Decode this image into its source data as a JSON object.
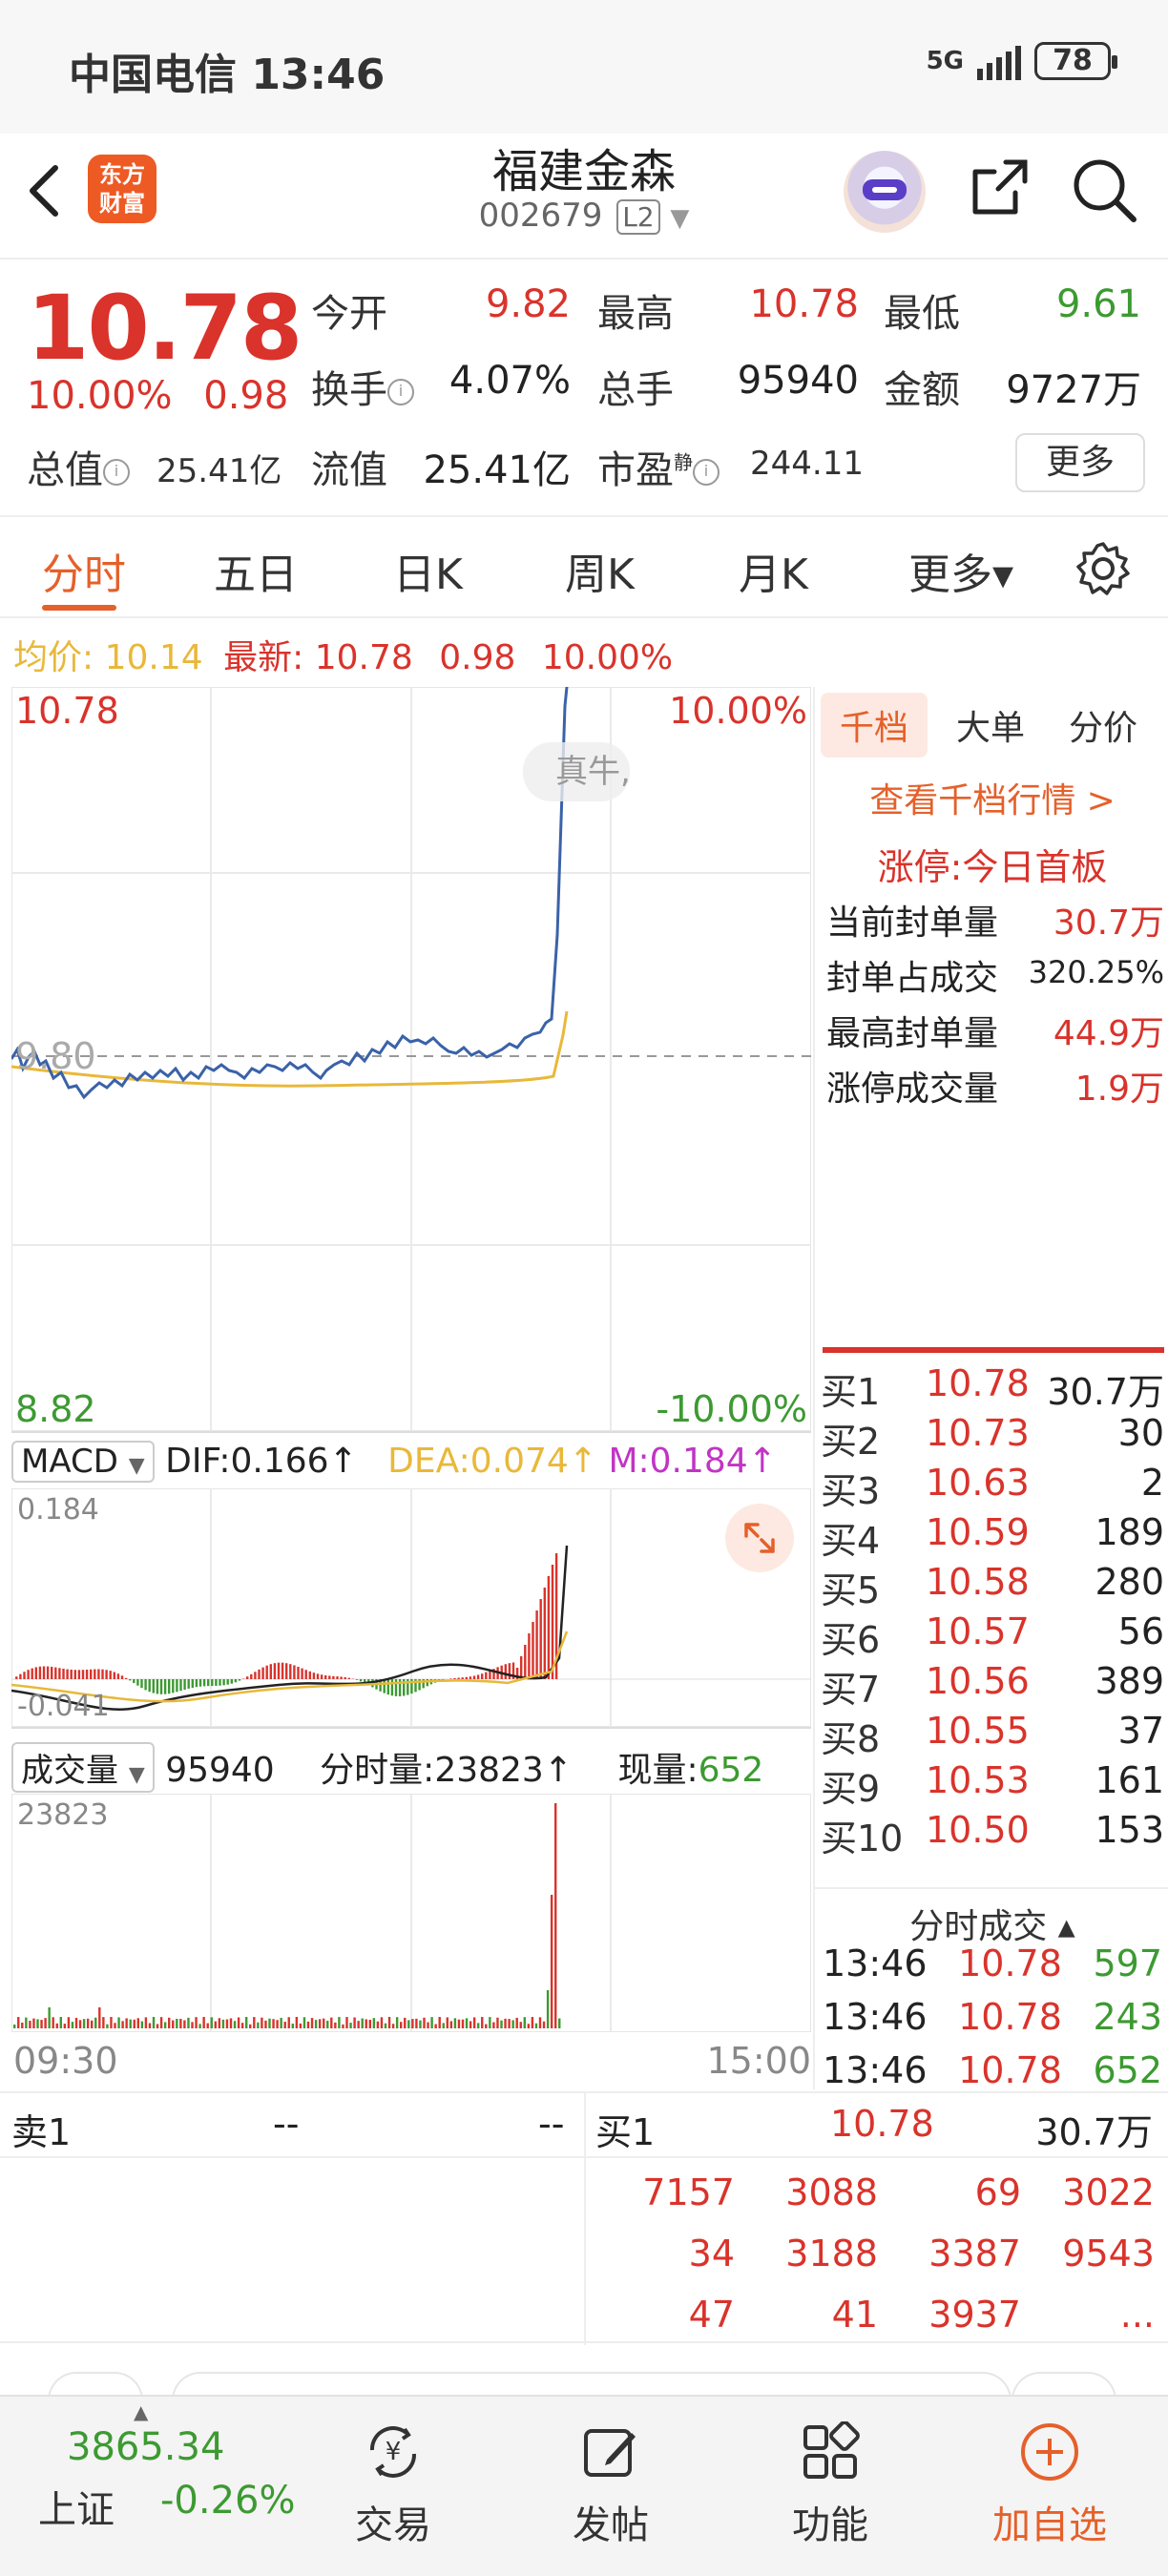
{
  "status_bar": {
    "carrier_time": "中国电信 13:46",
    "network": "5G",
    "battery": "78"
  },
  "header": {
    "logo_text": "东方\n财富",
    "stock_name": "福建金森",
    "stock_code": "002679",
    "level": "L2"
  },
  "quote": {
    "price": "10.78",
    "change_pct": "10.00%",
    "change_amt": "0.98",
    "open_label": "今开",
    "open": "9.82",
    "high_label": "最高",
    "high": "10.78",
    "low_label": "最低",
    "low": "9.61",
    "turnover_label": "换手",
    "turnover": "4.07%",
    "volume_label": "总手",
    "volume": "95940",
    "amount_label": "金额",
    "amount": "9727万",
    "mktcap_label": "总值",
    "mktcap": "25.41亿",
    "float_label": "流值",
    "float": "25.41亿",
    "pe_label": "市盈",
    "pe_sup": "静",
    "pe": "244.11",
    "more_button": "更多"
  },
  "tabs": [
    "分时",
    "五日",
    "日K",
    "周K",
    "月K",
    "更多▾"
  ],
  "avg_line": {
    "avg_label": "均价:",
    "avg": "10.14",
    "latest_label": "最新:",
    "latest": "10.78",
    "chg": "0.98",
    "pct": "10.00%"
  },
  "chart": {
    "top_price": "10.78",
    "top_pct": "10.00%",
    "mid_price": "9.80",
    "bottom_price": "8.82",
    "bottom_pct": "-10.00%",
    "watermark": "真牛,"
  },
  "macd": {
    "selector": "MACD",
    "dif": "DIF:0.166↑",
    "dea": "DEA:0.074↑",
    "m": "M:0.184↑",
    "max": "0.184",
    "min": "-0.041"
  },
  "volume_panel": {
    "selector": "成交量",
    "total": "95940",
    "min_label": "分时量:",
    "min_vol": "23823↑",
    "now_label": "现量:",
    "now": "652",
    "max": "23823"
  },
  "time_axis": {
    "start": "09:30",
    "end": "15:00"
  },
  "right_panel": {
    "tabs": [
      "千档",
      "大单",
      "分价"
    ],
    "link": "查看千档行情 >",
    "limit_head": "涨停:今日首板",
    "stats": [
      {
        "label": "当前封单量",
        "value": "30.7万"
      },
      {
        "label": "封单占成交",
        "value": "320.25%"
      },
      {
        "label": "最高封单量",
        "value": "44.9万"
      },
      {
        "label": "涨停成交量",
        "value": "1.9万"
      }
    ],
    "bids": [
      {
        "level": "买1",
        "price": "10.78",
        "vol": "30.7万"
      },
      {
        "level": "买2",
        "price": "10.73",
        "vol": "30"
      },
      {
        "level": "买3",
        "price": "10.63",
        "vol": "2"
      },
      {
        "level": "买4",
        "price": "10.59",
        "vol": "189"
      },
      {
        "level": "买5",
        "price": "10.58",
        "vol": "280"
      },
      {
        "level": "买6",
        "price": "10.57",
        "vol": "56"
      },
      {
        "level": "买7",
        "price": "10.56",
        "vol": "389"
      },
      {
        "level": "买8",
        "price": "10.55",
        "vol": "37"
      },
      {
        "level": "买9",
        "price": "10.53",
        "vol": "161"
      },
      {
        "level": "买10",
        "price": "10.50",
        "vol": "153"
      }
    ],
    "trades_head": "分时成交 ▴",
    "trades": [
      {
        "time": "13:46",
        "price": "10.78",
        "vol": "597"
      },
      {
        "time": "13:46",
        "price": "10.78",
        "vol": "243"
      },
      {
        "time": "13:46",
        "price": "10.78",
        "vol": "652"
      }
    ]
  },
  "bottom_book": {
    "sell1_label": "卖1",
    "sell1_price": "--",
    "sell1_vol": "--",
    "buy1_label": "买1",
    "buy1_price": "10.78",
    "buy1_vol": "30.7万",
    "queue": [
      [
        "7157",
        "3088",
        "69",
        "3022"
      ],
      [
        "34",
        "3188",
        "3387",
        "9543"
      ],
      [
        "47",
        "41",
        "3937",
        "..."
      ]
    ]
  },
  "nav": {
    "index_value": "3865.34",
    "index_name": "上证",
    "index_change": "-0.26%",
    "items": [
      "交易",
      "发帖",
      "功能",
      "加自选"
    ]
  },
  "colors": {
    "up": "#d9332b",
    "down": "#3c9a31",
    "accent": "#e5602a",
    "price_line": "#3a62a8",
    "avg_line": "#e9b83a"
  }
}
